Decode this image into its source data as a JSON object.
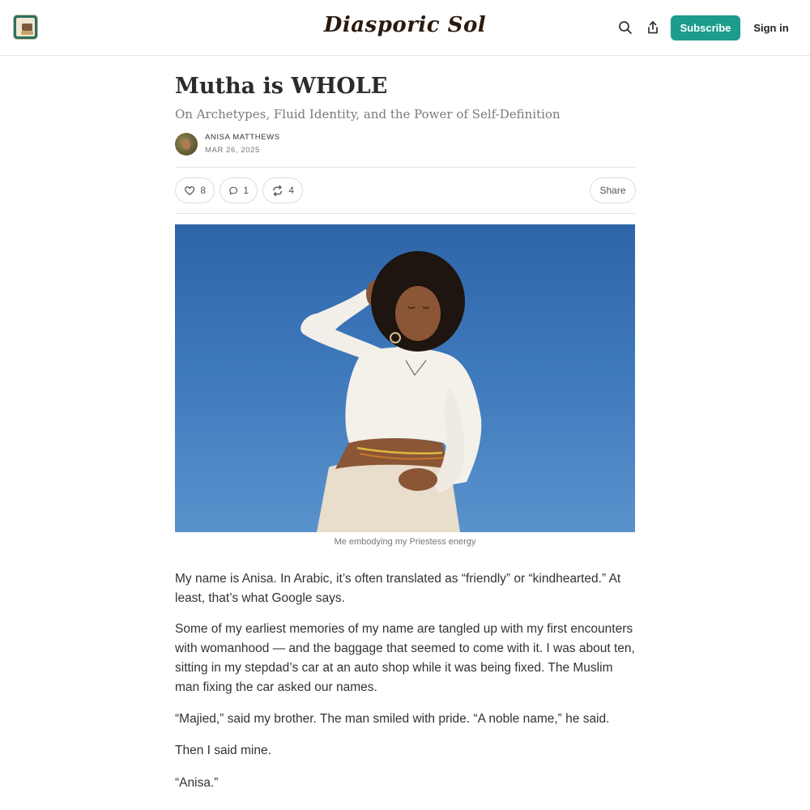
{
  "header": {
    "publication_name": "Diasporic Sol",
    "subscribe_label": "Subscribe",
    "signin_label": "Sign in"
  },
  "article": {
    "title": "Mutha is WHOLE",
    "subtitle": "On Archetypes, Fluid Identity, and the Power of Self-Definition",
    "author": "ANISA MATTHEWS",
    "date": "MAR 26, 2025",
    "likes": "8",
    "comments": "1",
    "restacks": "4",
    "share_label": "Share",
    "image_caption": "Me embodying my Priestess energy",
    "paragraphs": [
      "My name is Anisa. In Arabic, it’s often translated as “friendly” or “kindhearted.” At least, that’s what Google says.",
      "Some of my earliest memories of my name are tangled up with my first encounters with womanhood — and the baggage that seemed to come with it. I was about ten, sitting in my stepdad’s car at an auto shop while it was being fixed. The Muslim man fixing the car asked our names.",
      "“Majied,” said my brother. The man smiled with pride. “A noble name,” he said.",
      "Then I said mine.",
      "“Anisa.”"
    ]
  },
  "icons": {
    "search": "search-icon",
    "share": "share-icon",
    "like": "heart-icon",
    "comment": "comment-bubble-icon",
    "restack": "restack-icon"
  },
  "colors": {
    "accent": "#1b9c8c",
    "sky": "#3d78bb"
  }
}
